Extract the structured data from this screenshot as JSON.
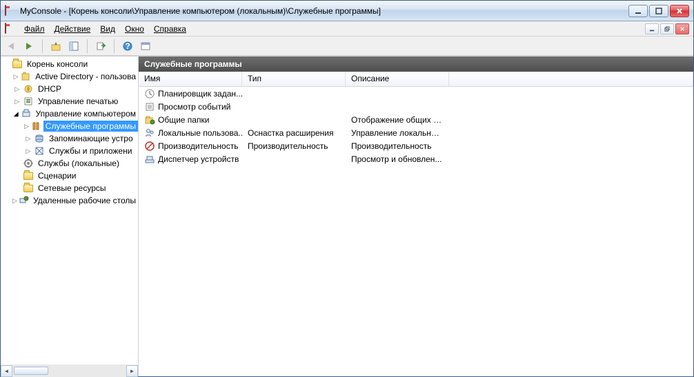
{
  "titlebar": {
    "title": "MyConsole - [Корень консоли\\Управление компьютером (локальным)\\Служебные программы]"
  },
  "menu": {
    "file": "Файл",
    "action": "Действие",
    "view": "Вид",
    "window": "Окно",
    "help": "Справка"
  },
  "tree": {
    "root": "Корень консоли",
    "items": [
      {
        "label": "Active Directory - пользова",
        "depth": 1,
        "expandable": true
      },
      {
        "label": "DHCP",
        "depth": 1,
        "expandable": true
      },
      {
        "label": "Управление печатью",
        "depth": 1,
        "expandable": true
      },
      {
        "label": "Управление компьютером",
        "depth": 1,
        "expandable": true,
        "expanded": true
      },
      {
        "label": "Служебные программы",
        "depth": 2,
        "expandable": true,
        "selected": true
      },
      {
        "label": "Запоминающие устро",
        "depth": 2,
        "expandable": true
      },
      {
        "label": "Службы и приложени",
        "depth": 2,
        "expandable": true
      },
      {
        "label": "Службы (локальные)",
        "depth": 1,
        "expandable": false
      },
      {
        "label": "Сценарии",
        "depth": 1,
        "expandable": false
      },
      {
        "label": "Сетевые ресурсы",
        "depth": 1,
        "expandable": false
      },
      {
        "label": "Удаленные рабочие столы",
        "depth": 1,
        "expandable": true
      }
    ]
  },
  "main": {
    "header": "Служебные программы",
    "cols": {
      "name": "Имя",
      "type": "Тип",
      "desc": "Описание"
    },
    "rows": [
      {
        "name": "Планировщик задан...",
        "type": "",
        "desc": ""
      },
      {
        "name": "Просмотр событий",
        "type": "",
        "desc": ""
      },
      {
        "name": "Общие папки",
        "type": "",
        "desc": "Отображение общих п..."
      },
      {
        "name": "Локальные пользова...",
        "type": "Оснастка расширения",
        "desc": "Управление локальны..."
      },
      {
        "name": "Производительность",
        "type": "Производительность",
        "desc": "Производительность"
      },
      {
        "name": "Диспетчер устройств",
        "type": "",
        "desc": "Просмотр и обновлен..."
      }
    ]
  }
}
